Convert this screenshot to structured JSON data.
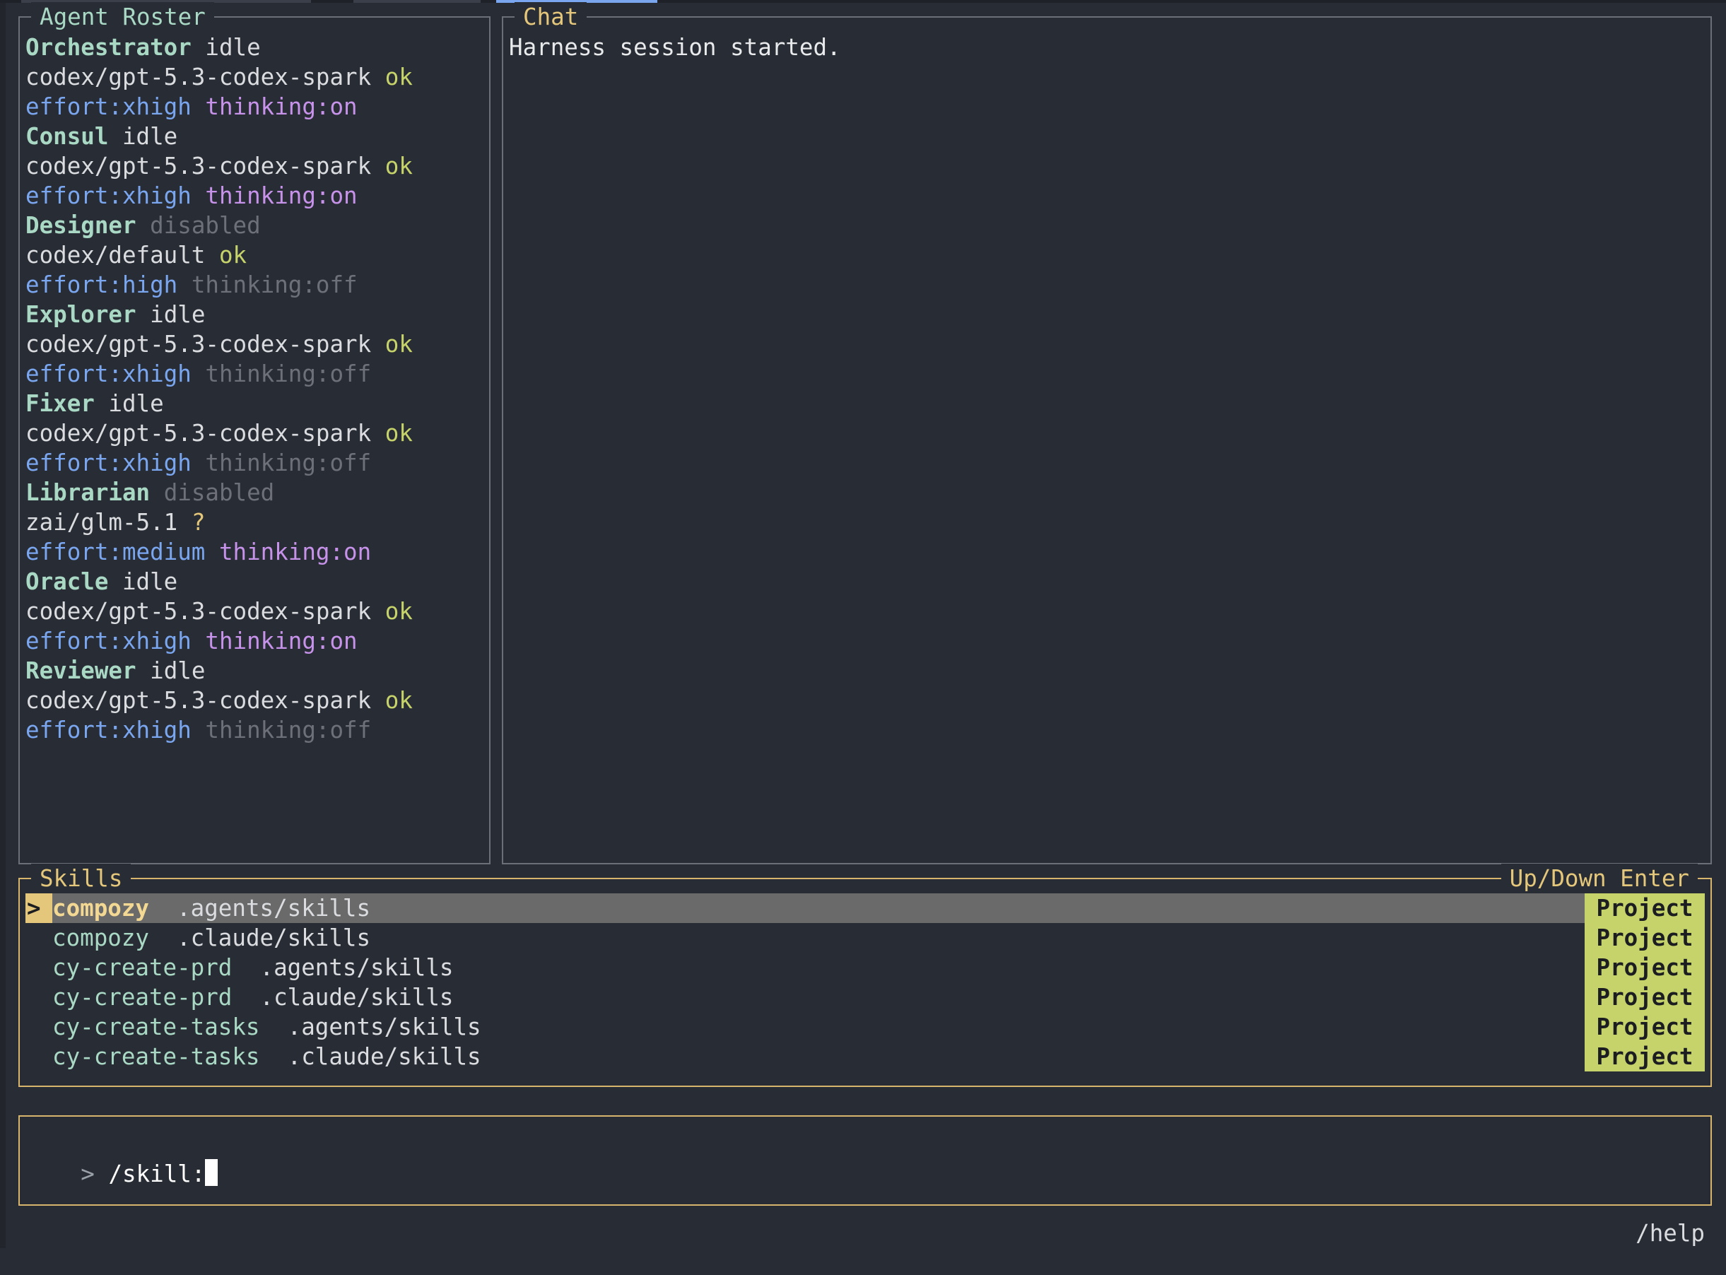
{
  "roster": {
    "title": "Agent Roster",
    "agents": [
      {
        "name": "Orchestrator",
        "status": "idle",
        "status_kind": "idle",
        "model": "codex/gpt-5.3-codex-spark",
        "health": "ok",
        "health_kind": "ok",
        "effort": "effort:xhigh",
        "thinking": "thinking:on",
        "thinking_kind": "on"
      },
      {
        "name": "Consul",
        "status": "idle",
        "status_kind": "idle",
        "model": "codex/gpt-5.3-codex-spark",
        "health": "ok",
        "health_kind": "ok",
        "effort": "effort:xhigh",
        "thinking": "thinking:on",
        "thinking_kind": "on"
      },
      {
        "name": "Designer",
        "status": "disabled",
        "status_kind": "disabled",
        "model": "codex/default",
        "health": "ok",
        "health_kind": "ok",
        "effort": "effort:high",
        "thinking": "thinking:off",
        "thinking_kind": "off"
      },
      {
        "name": "Explorer",
        "status": "idle",
        "status_kind": "idle",
        "model": "codex/gpt-5.3-codex-spark",
        "health": "ok",
        "health_kind": "ok",
        "effort": "effort:xhigh",
        "thinking": "thinking:off",
        "thinking_kind": "off"
      },
      {
        "name": "Fixer",
        "status": "idle",
        "status_kind": "idle",
        "model": "codex/gpt-5.3-codex-spark",
        "health": "ok",
        "health_kind": "ok",
        "effort": "effort:xhigh",
        "thinking": "thinking:off",
        "thinking_kind": "off"
      },
      {
        "name": "Librarian",
        "status": "disabled",
        "status_kind": "disabled",
        "model": "zai/glm-5.1",
        "health": "?",
        "health_kind": "unknown",
        "effort": "effort:medium",
        "thinking": "thinking:on",
        "thinking_kind": "on"
      },
      {
        "name": "Oracle",
        "status": "idle",
        "status_kind": "idle",
        "model": "codex/gpt-5.3-codex-spark",
        "health": "ok",
        "health_kind": "ok",
        "effort": "effort:xhigh",
        "thinking": "thinking:on",
        "thinking_kind": "on"
      },
      {
        "name": "Reviewer",
        "status": "idle",
        "status_kind": "idle",
        "model": "codex/gpt-5.3-codex-spark",
        "health": "ok",
        "health_kind": "ok",
        "effort": "effort:xhigh",
        "thinking": "thinking:off",
        "thinking_kind": "off"
      }
    ]
  },
  "chat": {
    "title": "Chat",
    "messages": [
      "Harness session started."
    ]
  },
  "skills": {
    "title": "Skills",
    "hint": "Up/Down Enter",
    "selected_marker": ">",
    "items": [
      {
        "name": "compozy",
        "path": ".agents/skills",
        "scope": "Project",
        "selected": true
      },
      {
        "name": "compozy",
        "path": ".claude/skills",
        "scope": "Project",
        "selected": false
      },
      {
        "name": "cy-create-prd",
        "path": ".agents/skills",
        "scope": "Project",
        "selected": false
      },
      {
        "name": "cy-create-prd",
        "path": ".claude/skills",
        "scope": "Project",
        "selected": false
      },
      {
        "name": "cy-create-tasks",
        "path": ".agents/skills",
        "scope": "Project",
        "selected": false
      },
      {
        "name": "cy-create-tasks",
        "path": ".claude/skills",
        "scope": "Project",
        "selected": false
      }
    ]
  },
  "input": {
    "prompt": ">",
    "value": "/skill:"
  },
  "footer": {
    "help": "/help"
  },
  "colors": {
    "background": "#282c34",
    "accent_yellow": "#e4c77a",
    "agent_name": "#a9d9c5",
    "ok": "#c6d36a",
    "effort": "#7aa6f0",
    "thinking_on": "#c792ea",
    "muted": "#6d7079"
  }
}
